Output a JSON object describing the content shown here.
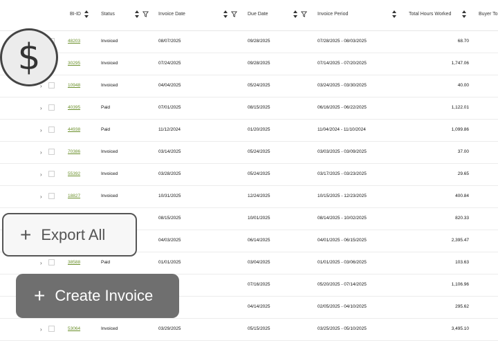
{
  "columns": {
    "bi_id": "BI-ID",
    "status": "Status",
    "invoice_date": "Invoice Date",
    "due_date": "Due Date",
    "invoice_period": "Invoice Period",
    "total_hours": "Total Hours Worked",
    "buyer_total": "Buyer To"
  },
  "rows": [
    {
      "id": "48203",
      "status": "Invoiced",
      "invoice_date": "08/07/2025",
      "due_date": "09/28/2025",
      "period": "07/28/2025 - 08/03/2025",
      "hours": "68.70"
    },
    {
      "id": "30295",
      "status": "Invoiced",
      "invoice_date": "07/24/2025",
      "due_date": "09/28/2025",
      "period": "07/14/2025 - 07/20/2025",
      "hours": "1,747.06"
    },
    {
      "id": "10948",
      "status": "Invoiced",
      "invoice_date": "04/04/2025",
      "due_date": "05/24/2025",
      "period": "03/24/2025 - 03/30/2025",
      "hours": "40.00"
    },
    {
      "id": "40395",
      "status": "Paid",
      "invoice_date": "07/01/2025",
      "due_date": "08/15/2025",
      "period": "06/16/2025 - 06/22/2025",
      "hours": "1,122.01"
    },
    {
      "id": "44938",
      "status": "Paid",
      "invoice_date": "11/12/2024",
      "due_date": "01/20/2025",
      "period": "11/04/2024 - 11/10/2024",
      "hours": "1,099.86"
    },
    {
      "id": "70386",
      "status": "Invoiced",
      "invoice_date": "03/14/2025",
      "due_date": "05/24/2025",
      "period": "03/03/2025 - 03/09/2025",
      "hours": "37.00"
    },
    {
      "id": "55392",
      "status": "Invoiced",
      "invoice_date": "03/28/2025",
      "due_date": "05/24/2025",
      "period": "03/17/2025 - 03/23/2025",
      "hours": "29.65"
    },
    {
      "id": "18827",
      "status": "Invoiced",
      "invoice_date": "10/31/2025",
      "due_date": "12/24/2025",
      "period": "10/15/2025 - 12/23/2025",
      "hours": "400.84"
    },
    {
      "id": "",
      "status": "",
      "invoice_date": "08/15/2025",
      "due_date": "10/01/2025",
      "period": "08/14/2025 - 10/02/2025",
      "hours": "820.33"
    },
    {
      "id": "",
      "status": "",
      "invoice_date": "04/03/2025",
      "due_date": "06/14/2025",
      "period": "04/01/2025 - 06/15/2025",
      "hours": "2,395.47"
    },
    {
      "id": "38588",
      "status": "Paid",
      "invoice_date": "01/01/2025",
      "due_date": "03/04/2025",
      "period": "01/01/2025 - 03/06/2025",
      "hours": "103.63"
    },
    {
      "id": "",
      "status": "",
      "invoice_date": "25",
      "due_date": "07/16/2025",
      "period": "05/20/2025 - 07/14/2025",
      "hours": "1,106.96"
    },
    {
      "id": "",
      "status": "",
      "invoice_date": "25",
      "due_date": "04/14/2025",
      "period": "02/05/2025 - 04/10/2025",
      "hours": "295.62"
    },
    {
      "id": "53064",
      "status": "Invoiced",
      "invoice_date": "03/29/2025",
      "due_date": "05/15/2025",
      "period": "03/25/2025 - 05/10/2025",
      "hours": "3,495.10"
    }
  ],
  "money_icon": "dollar-sign-icon",
  "money_glyph": "$",
  "export_label": "Export All",
  "create_label": "Create Invoice"
}
